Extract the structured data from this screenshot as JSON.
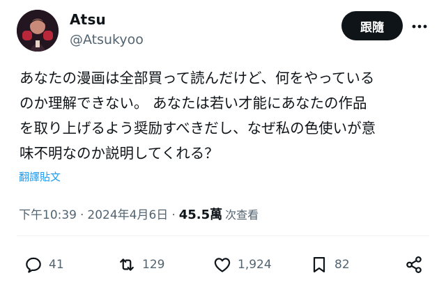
{
  "author": {
    "display_name": "Atsu",
    "handle": "@Atsukyoo"
  },
  "header": {
    "follow_label": "跟隨"
  },
  "post": {
    "text": "あなたの漫画は全部買って読んだけど、何をやっている\nのか理解できない。 あなたは若い才能にあなたの作品\nを取り上げるよう奨励すべきだし、なぜ私の色使いが意\n味不明なのか説明してくれる？",
    "translate_label": "翻譯貼文",
    "time": "下午10:39",
    "separator": "·",
    "date": "2024年4月6日",
    "views_count": "45.5萬",
    "views_label": "次查看"
  },
  "actions": {
    "reply_count": "41",
    "repost_count": "129",
    "like_count": "1,924",
    "bookmark_count": "82"
  },
  "icons": {
    "more": "more-horizontal-icon",
    "reply": "reply-icon",
    "repost": "repost-icon",
    "like": "heart-icon",
    "bookmark": "bookmark-icon",
    "share": "share-icon"
  },
  "colors": {
    "text_primary": "#0f1419",
    "text_secondary": "#536471",
    "link": "#1d9bf0",
    "button_bg": "#0f1419"
  }
}
